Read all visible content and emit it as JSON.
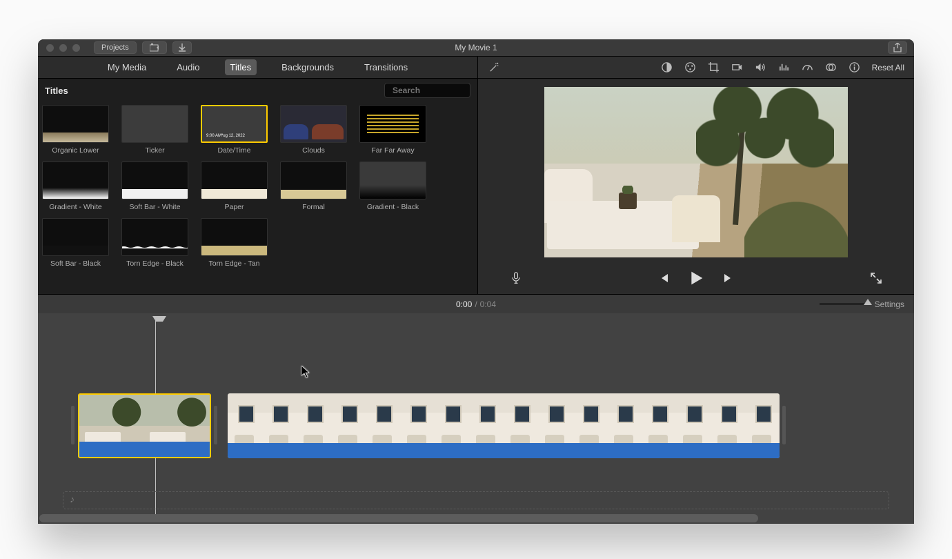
{
  "window": {
    "title": "My Movie 1"
  },
  "toolbar": {
    "projects": "Projects"
  },
  "mediaTabs": {
    "items": [
      "My Media",
      "Audio",
      "Titles",
      "Backgrounds",
      "Transitions"
    ],
    "active": 2
  },
  "browser": {
    "title": "Titles",
    "search_placeholder": "Search",
    "selected": 2,
    "items": [
      {
        "label": "Organic Lower",
        "variant": "v-organic"
      },
      {
        "label": "Ticker",
        "variant": "v-ticker"
      },
      {
        "label": "Date/Time",
        "variant": "v-datetime"
      },
      {
        "label": "Clouds",
        "variant": "v-clouds"
      },
      {
        "label": "Far Far Away",
        "variant": "v-farfar"
      },
      {
        "label": "Gradient - White",
        "variant": "v-gwhite"
      },
      {
        "label": "Soft Bar - White",
        "variant": "v-sbwhite"
      },
      {
        "label": "Paper",
        "variant": "v-paper"
      },
      {
        "label": "Formal",
        "variant": "v-formal"
      },
      {
        "label": "Gradient - Black",
        "variant": "v-gblack"
      },
      {
        "label": "Soft Bar - Black",
        "variant": "v-sbblack"
      },
      {
        "label": "Torn Edge - Black",
        "variant": "v-tornb"
      },
      {
        "label": "Torn Edge - Tan",
        "variant": "v-torntan"
      }
    ]
  },
  "adjustBar": {
    "reset": "Reset All",
    "tools": [
      "enhance",
      "color-balance",
      "color-wheel",
      "crop",
      "stabilize",
      "volume",
      "noise-reduce",
      "speed",
      "color-filter",
      "info"
    ]
  },
  "playControls": {
    "items": [
      "prev",
      "play",
      "next"
    ]
  },
  "time": {
    "current": "0:00",
    "duration": "0:04",
    "settings": "Settings"
  },
  "timeline": {
    "clips": [
      {
        "id": "clip1",
        "selected": true,
        "frames": 2
      },
      {
        "id": "clip2",
        "selected": false,
        "frames": 16
      }
    ]
  }
}
